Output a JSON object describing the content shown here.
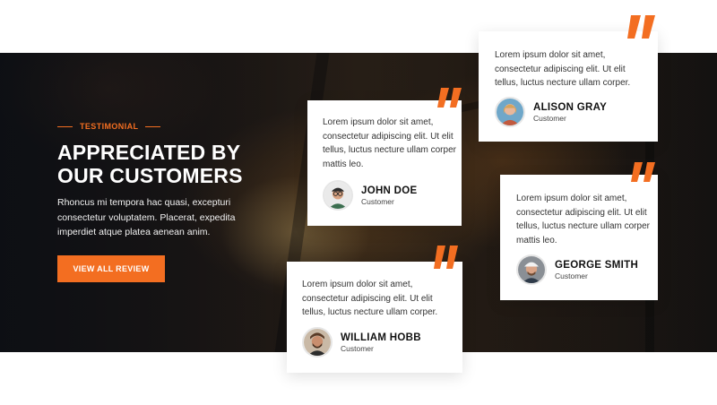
{
  "section": {
    "eyebrow": "TESTIMONIAL",
    "headline_line1": "APPRECIATED BY",
    "headline_line2": "OUR CUSTOMERS",
    "description": "Rhoncus mi tempora hac quasi, excepturi consectetur voluptatem. Placerat, expedita imperdiet atque platea aenean anim.",
    "cta_label": "VIEW ALL REVIEW",
    "accent_color": "#f36e21"
  },
  "testimonials": [
    {
      "text": "Lorem ipsum dolor sit amet, consectetur adipiscing elit. Ut elit tellus, luctus necture ullam corper.",
      "name": "ALISON GRAY",
      "role": "Customer",
      "icon": "quote-icon"
    },
    {
      "text": "Lorem ipsum dolor sit amet, consectetur adipiscing elit. Ut elit tellus, luctus necture ullam corper mattis leo.",
      "name": "JOHN DOE",
      "role": "Customer",
      "icon": "quote-icon"
    },
    {
      "text": "Lorem ipsum dolor sit amet, consectetur adipiscing elit. Ut elit tellus, luctus necture ullam corper mattis leo.",
      "name": "GEORGE SMITH",
      "role": "Customer",
      "icon": "quote-icon"
    },
    {
      "text": "Lorem ipsum dolor sit amet, consectetur adipiscing elit. Ut elit tellus, luctus necture ullam corper.",
      "name": "WILLIAM HOBB",
      "role": "Customer",
      "icon": "quote-icon"
    }
  ]
}
